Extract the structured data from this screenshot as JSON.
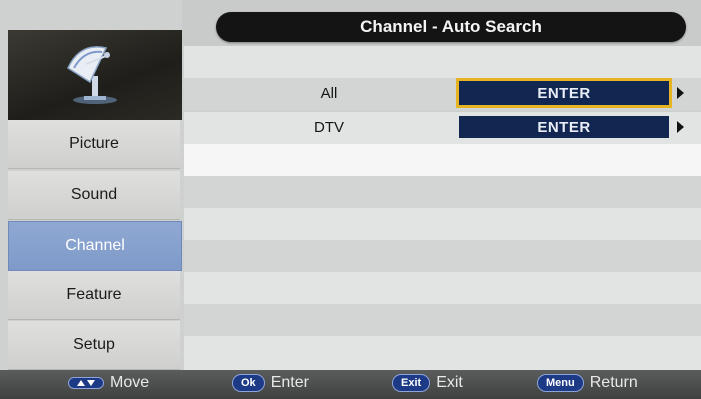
{
  "header": {
    "title": "Channel - Auto Search"
  },
  "sidebar": {
    "icon": "satellite-dish-icon",
    "items": [
      {
        "label": "Picture",
        "active": false
      },
      {
        "label": "Sound",
        "active": false
      },
      {
        "label": "Channel",
        "active": true
      },
      {
        "label": "Feature",
        "active": false
      },
      {
        "label": "Setup",
        "active": false
      }
    ]
  },
  "options": [
    {
      "label": "All",
      "button": "ENTER",
      "selected": true
    },
    {
      "label": "DTV",
      "button": "ENTER",
      "selected": false
    }
  ],
  "footer": {
    "hints": [
      {
        "key": "",
        "key_icon": "up-down-arrows-icon",
        "label": "Move"
      },
      {
        "key": "Ok",
        "label": "Enter"
      },
      {
        "key": "Exit",
        "label": "Exit"
      },
      {
        "key": "Menu",
        "label": "Return"
      }
    ]
  },
  "colors": {
    "selected_outline": "#e6b422",
    "button_bg": "#112650",
    "active_menu": "#8fa8d3"
  }
}
